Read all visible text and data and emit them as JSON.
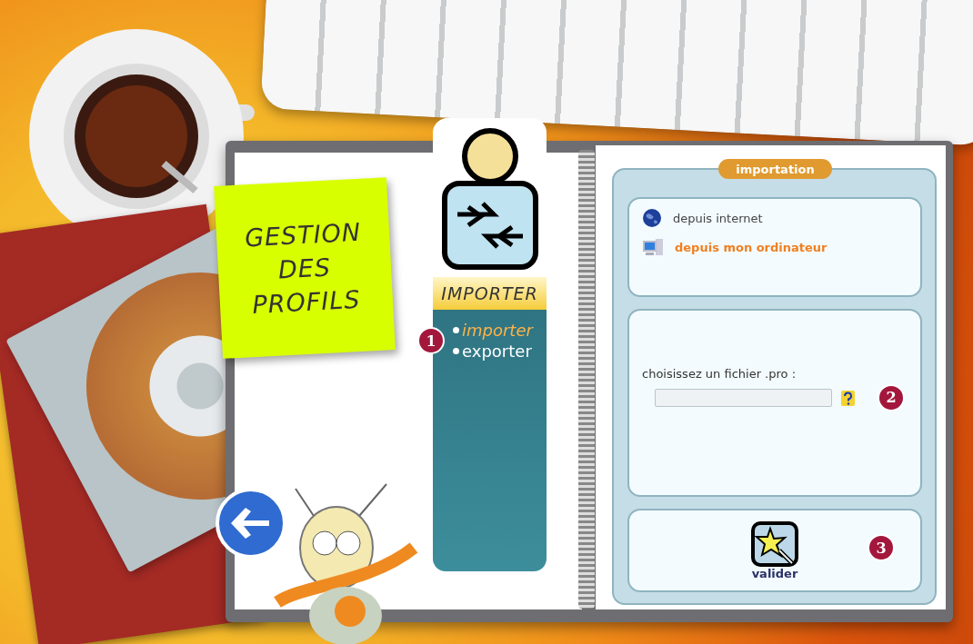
{
  "note": {
    "lines": [
      "GESTION",
      "DES",
      "PROFILS"
    ]
  },
  "module": {
    "label": "IMPORTER",
    "step": "1",
    "menu": [
      {
        "label": "importer",
        "selected": true
      },
      {
        "label": "exporter",
        "selected": false
      }
    ]
  },
  "panel": {
    "title": "importation",
    "sources": [
      {
        "kind": "internet",
        "label": "depuis internet",
        "selected": false
      },
      {
        "kind": "computer",
        "label": "depuis mon ordinateur",
        "selected": true
      }
    ],
    "file_label": "choisissez un fichier .pro :",
    "file_step": "2",
    "submit": {
      "label": "valider",
      "step": "3"
    }
  }
}
